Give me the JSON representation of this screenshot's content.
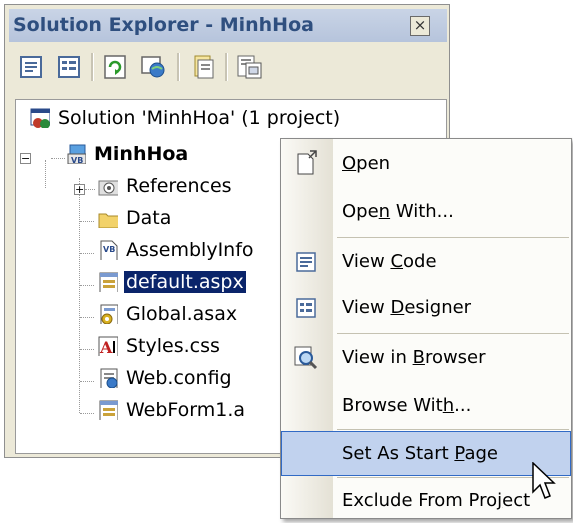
{
  "window": {
    "title": "Solution Explorer - MinhHoa",
    "close_glyph": "×"
  },
  "toolbar": {
    "buttons": [
      "properties-icon",
      "show-all-files-icon",
      "refresh-icon",
      "copy-website-icon",
      "view-code-icon",
      "view-designer-icon"
    ]
  },
  "tree": {
    "solution": "Solution 'MinhHoa' (1 project)",
    "project": "MinhHoa",
    "items": [
      "References",
      "Data",
      "AssemblyInfo",
      "default.aspx",
      "Global.asax",
      "Styles.css",
      "Web.config",
      "WebForm1.a"
    ]
  },
  "context_menu": {
    "items": [
      {
        "pre": "",
        "key": "O",
        "post": "pen"
      },
      {
        "pre": "Ope",
        "key": "n",
        "post": " With..."
      },
      {
        "pre": "View ",
        "key": "C",
        "post": "ode"
      },
      {
        "pre": "View ",
        "key": "D",
        "post": "esigner"
      },
      {
        "pre": "View in ",
        "key": "B",
        "post": "rowser"
      },
      {
        "pre": "Browse Wit",
        "key": "h",
        "post": "..."
      },
      {
        "pre": "Set As Start ",
        "key": "P",
        "post": "age"
      },
      {
        "pre": "Exclude From Pro",
        "key": "j",
        "post": "ect"
      }
    ],
    "highlighted_index": 6
  },
  "colors": {
    "selection": "#0a246a",
    "menu_highlight": "#c1d2ee",
    "menu_highlight_border": "#316ac5",
    "title_text": "#2f4f7f"
  }
}
